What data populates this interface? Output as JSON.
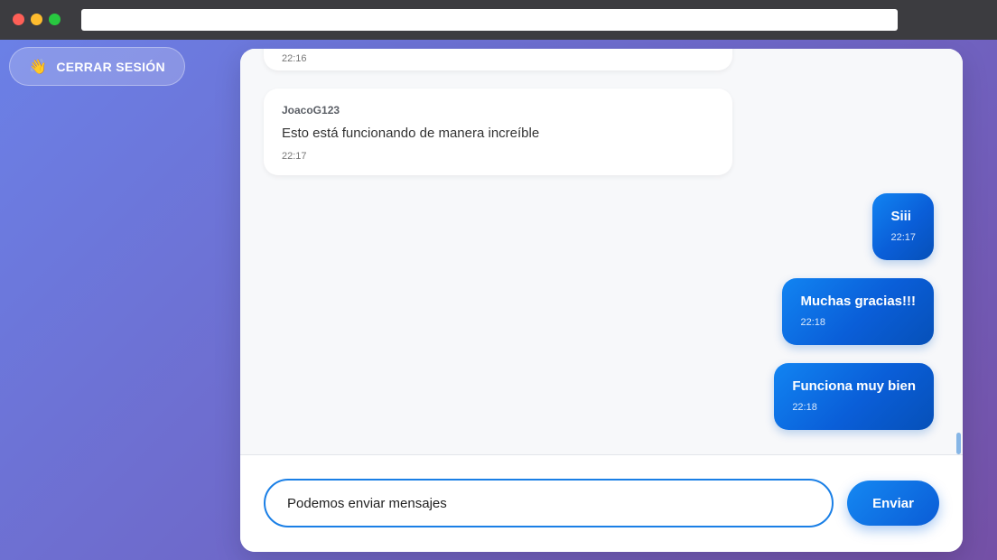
{
  "header": {
    "logout_icon": "👋",
    "logout_label": "CERRAR SESIÓN"
  },
  "messages": [
    {
      "direction": "incoming",
      "time": "22:16"
    },
    {
      "direction": "incoming",
      "sender": "JoacoG123",
      "text": "Esto está funcionando de manera increíble",
      "time": "22:17"
    },
    {
      "direction": "outgoing",
      "text": "Siii",
      "time": "22:17"
    },
    {
      "direction": "outgoing",
      "text": "Muchas gracias!!!",
      "time": "22:18"
    },
    {
      "direction": "outgoing",
      "text": "Funciona muy bien",
      "time": "22:18"
    }
  ],
  "composer": {
    "value": "Podemos enviar mensajes",
    "send_label": "Enviar"
  },
  "colors": {
    "accent": "#0a66dc",
    "background_start": "#6b80e6",
    "background_end": "#7450a6"
  }
}
